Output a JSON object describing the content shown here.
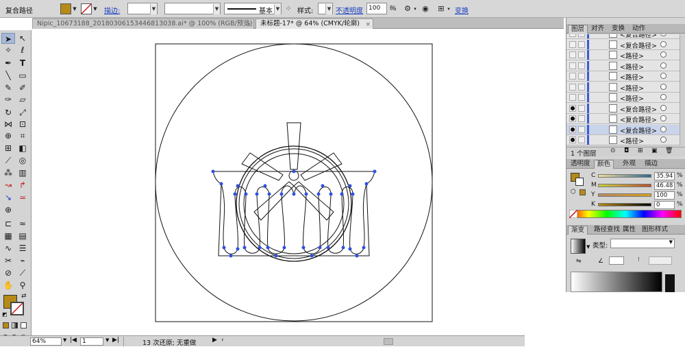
{
  "control_bar": {
    "selection_type": "复合路径",
    "stroke_label": "描边:",
    "stroke_width_value": "",
    "brush_value": "",
    "stroke_style_label": "基本",
    "style_label": "样式:",
    "opacity_label": "不透明度",
    "opacity_value": "100",
    "opacity_unit": "%",
    "transform_label": "变换",
    "fill_color": "#b68a17"
  },
  "tabs": [
    {
      "title": "Nipic_10673188_20180306153446813038.ai* @ 100% (RGB/预览)",
      "active": false
    },
    {
      "title": "未标题-17* @ 64% (CMYK/轮廓)",
      "active": true
    }
  ],
  "close_glyph": "×",
  "toolbox": {
    "fill_color": "#b68a17",
    "tools": [
      "selection-tool",
      "direct-selection-tool",
      "magic-wand-tool",
      "lasso-tool",
      "pen-tool",
      "type-tool",
      "line-tool",
      "rectangle-tool",
      "paintbrush-tool",
      "pencil-tool",
      "blob-brush-tool",
      "eraser-tool",
      "rotate-tool",
      "scale-tool",
      "width-tool",
      "free-transform-tool",
      "shape-builder-tool",
      "perspective-grid-tool",
      "mesh-tool",
      "gradient-tool",
      "eyedropper-tool",
      "blend-tool",
      "symbol-sprayer-tool",
      "column-graph-tool",
      "artboard-tool",
      "slice-tool",
      "hand-tool",
      "zoom-tool"
    ]
  },
  "status_bar": {
    "zoom": "64%",
    "artboard": "1",
    "status_text": "13 次还原; 无重做"
  },
  "layers_panel": {
    "tabs": [
      "图层",
      "对齐",
      "变换",
      "动作"
    ],
    "rows": [
      {
        "name": "<复合路径>",
        "visible": false,
        "selected": false
      },
      {
        "name": "<复合路径>",
        "visible": false,
        "selected": false
      },
      {
        "name": "<路径>",
        "visible": false,
        "selected": false
      },
      {
        "name": "<路径>",
        "visible": false,
        "selected": false
      },
      {
        "name": "<路径>",
        "visible": false,
        "selected": false
      },
      {
        "name": "<路径>",
        "visible": false,
        "selected": false
      },
      {
        "name": "<路径>",
        "visible": false,
        "selected": false
      },
      {
        "name": "<复合路径>",
        "visible": true,
        "selected": false
      },
      {
        "name": "<复合路径>",
        "visible": true,
        "selected": false
      },
      {
        "name": "<复合路径>",
        "visible": true,
        "selected": true
      },
      {
        "name": "<路径>",
        "visible": true,
        "selected": false
      }
    ],
    "footer_count": "1 个图层"
  },
  "color_panel": {
    "tabs": [
      "透明度",
      "颜色",
      "外观",
      "描边"
    ],
    "channels": [
      {
        "name": "C",
        "value": "35.94"
      },
      {
        "name": "M",
        "value": "46.48"
      },
      {
        "name": "Y",
        "value": "100"
      },
      {
        "name": "K",
        "value": "0"
      }
    ],
    "unit": "%",
    "swatch_color": "#b68a17"
  },
  "gradient_panel": {
    "tabs": [
      "渐变",
      "路径查找",
      "属性",
      "图形样式"
    ],
    "type_label": "类型:",
    "type_value": ""
  }
}
